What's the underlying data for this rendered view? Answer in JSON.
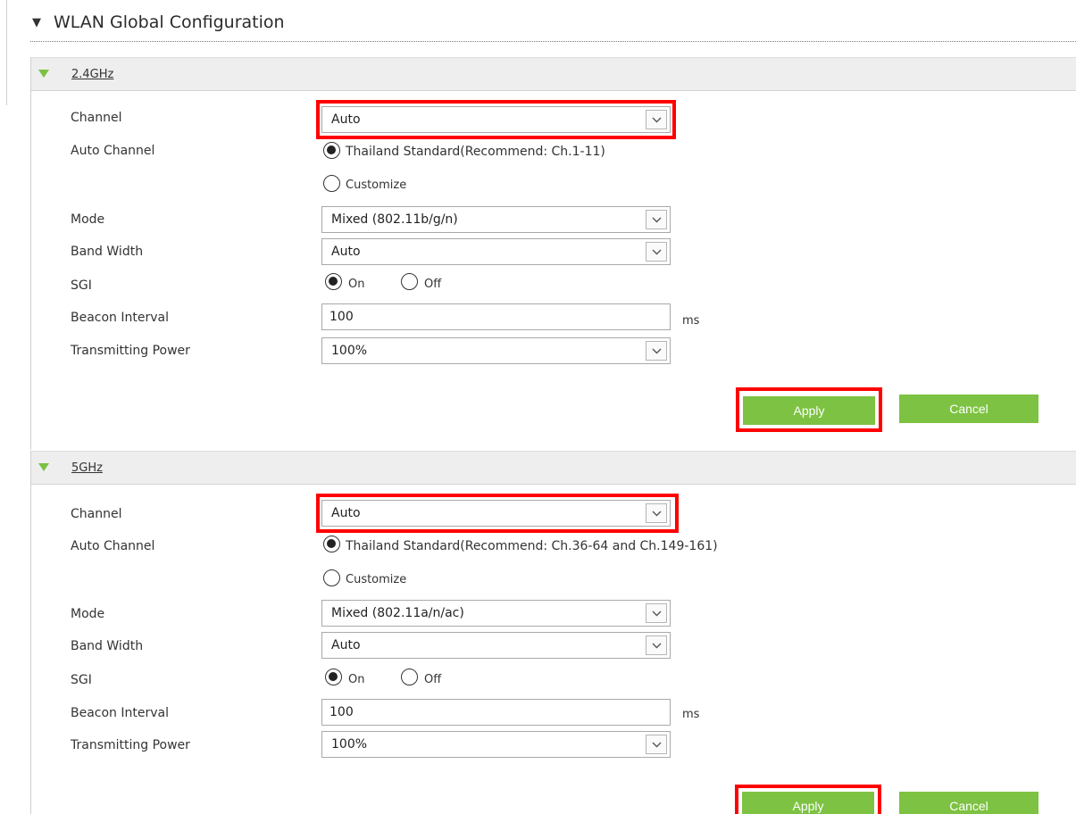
{
  "page": {
    "title": "WLAN Global Configuration"
  },
  "bands": [
    {
      "name": "2.4GHz",
      "channel": {
        "label": "Channel",
        "value": "Auto"
      },
      "auto_channel": {
        "label": "Auto Channel",
        "options": [
          "Thailand Standard(Recommend: Ch.1-11)",
          "Customize"
        ],
        "selected": 0
      },
      "mode": {
        "label": "Mode",
        "value": "Mixed (802.11b/g/n)"
      },
      "band_width": {
        "label": "Band Width",
        "value": "Auto"
      },
      "sgi": {
        "label": "SGI",
        "options": [
          "On",
          "Off"
        ],
        "selected": 0
      },
      "beacon_interval": {
        "label": "Beacon Interval",
        "value": "100",
        "unit": "ms"
      },
      "transmitting_power": {
        "label": "Transmitting Power",
        "value": "100%"
      },
      "apply_label": "Apply",
      "cancel_label": "Cancel"
    },
    {
      "name": "5GHz",
      "channel": {
        "label": "Channel",
        "value": "Auto"
      },
      "auto_channel": {
        "label": "Auto Channel",
        "options": [
          "Thailand Standard(Recommend: Ch.36-64 and Ch.149-161)",
          "Customize"
        ],
        "selected": 0
      },
      "mode": {
        "label": "Mode",
        "value": "Mixed (802.11a/n/ac)"
      },
      "band_width": {
        "label": "Band Width",
        "value": "Auto"
      },
      "sgi": {
        "label": "SGI",
        "options": [
          "On",
          "Off"
        ],
        "selected": 0
      },
      "beacon_interval": {
        "label": "Beacon Interval",
        "value": "100",
        "unit": "ms"
      },
      "transmitting_power": {
        "label": "Transmitting Power",
        "value": "100%"
      },
      "apply_label": "Apply",
      "cancel_label": "Cancel"
    }
  ],
  "colors": {
    "accent": "#7dc242",
    "highlight": "#ff0000",
    "band_bg": "#eeeeee"
  }
}
